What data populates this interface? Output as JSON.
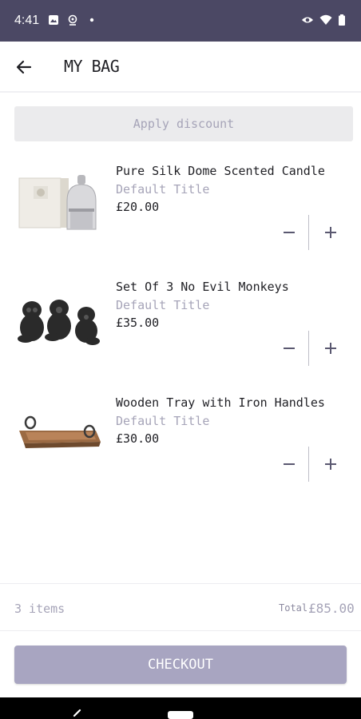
{
  "status": {
    "time": "4:41"
  },
  "header": {
    "title": "MY BAG"
  },
  "discount": {
    "label": "Apply discount"
  },
  "items": [
    {
      "name": "Pure Silk Dome Scented Candle",
      "variant": "Default Title",
      "price": "£20.00",
      "image": "candle-image"
    },
    {
      "name": "Set Of 3 No Evil Monkeys",
      "variant": "Default Title",
      "price": "£35.00",
      "image": "monkeys-image"
    },
    {
      "name": "Wooden Tray with Iron Handles",
      "variant": "Default Title",
      "price": "£30.00",
      "image": "tray-image"
    }
  ],
  "summary": {
    "count": "3 items",
    "total_label": "Total",
    "total": "£85.00"
  },
  "checkout": {
    "label": "CHECKOUT"
  },
  "colors": {
    "status_bar": "#4b4864",
    "accent": "#a8a5c1",
    "muted_text": "#a6a4b8"
  }
}
